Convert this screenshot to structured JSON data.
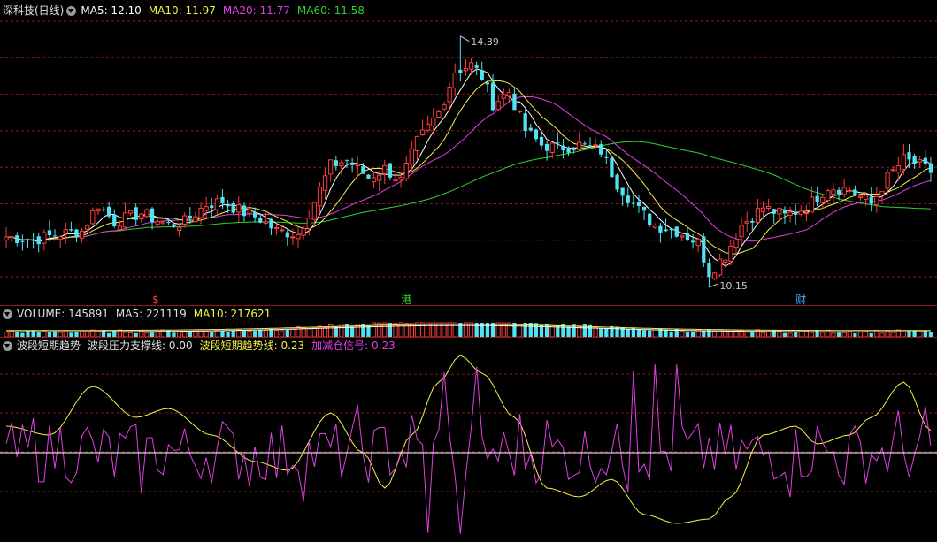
{
  "colors": {
    "up": "#ff3b3b",
    "down": "#50e3f3",
    "ma5": "#ffffff",
    "ma10": "#f4f04a",
    "ma20": "#e040e0",
    "ma60": "#30d030",
    "grid": "#8b1a1a",
    "zero_line": "#ffffff",
    "price_label": "#c8c8c8"
  },
  "main": {
    "title": "深科技(日线)",
    "ma5_label": "MA5: 12.10",
    "ma10_label": "MA10: 11.97",
    "ma20_label": "MA20: 11.77",
    "ma60_label": "MA60: 11.58",
    "high_label": "14.39",
    "low_label": "10.15",
    "markers": [
      {
        "text": "$",
        "color": "#ff3b3b",
        "x_index": 28
      },
      {
        "text": "港",
        "color": "#30d030",
        "x_index": 74
      },
      {
        "text": "财",
        "color": "#4aa8ff",
        "x_index": 147
      }
    ]
  },
  "volume": {
    "title": "VOLUME: 145891",
    "ma5_label": "MA5: 221119",
    "ma10_label": "MA10: 217621"
  },
  "indicator": {
    "title": "波段短期趋势",
    "support_label": "波段压力支撑线: 0.00",
    "trend_label": "波段短期趋势线: 0.23",
    "signal_label": "加减仓信号: 0.23"
  },
  "chart_data": {
    "type": "candlestick",
    "y_range": [
      10.0,
      14.7
    ],
    "count": 172,
    "anchors_close": [
      [
        0,
        11.0
      ],
      [
        5,
        10.95
      ],
      [
        10,
        11.05
      ],
      [
        14,
        11.1
      ],
      [
        17,
        11.55
      ],
      [
        20,
        11.25
      ],
      [
        25,
        11.4
      ],
      [
        30,
        11.2
      ],
      [
        33,
        11.25
      ],
      [
        37,
        11.55
      ],
      [
        40,
        11.6
      ],
      [
        43,
        11.45
      ],
      [
        47,
        11.3
      ],
      [
        50,
        11.1
      ],
      [
        54,
        11.05
      ],
      [
        57,
        11.6
      ],
      [
        60,
        12.2
      ],
      [
        63,
        12.3
      ],
      [
        67,
        12.0
      ],
      [
        70,
        12.15
      ],
      [
        73,
        11.95
      ],
      [
        76,
        12.6
      ],
      [
        80,
        13.1
      ],
      [
        83,
        13.8
      ],
      [
        86,
        13.9
      ],
      [
        88,
        13.7
      ],
      [
        90,
        13.25
      ],
      [
        93,
        13.45
      ],
      [
        96,
        12.8
      ],
      [
        99,
        12.55
      ],
      [
        102,
        12.5
      ],
      [
        106,
        12.55
      ],
      [
        110,
        12.45
      ],
      [
        113,
        11.9
      ],
      [
        117,
        11.45
      ],
      [
        120,
        11.2
      ],
      [
        124,
        11.1
      ],
      [
        128,
        10.9
      ],
      [
        130,
        10.4
      ],
      [
        133,
        10.7
      ],
      [
        136,
        11.2
      ],
      [
        140,
        11.5
      ],
      [
        144,
        11.35
      ],
      [
        148,
        11.5
      ],
      [
        152,
        11.85
      ],
      [
        156,
        11.8
      ],
      [
        160,
        11.55
      ],
      [
        163,
        12.0
      ],
      [
        166,
        12.3
      ],
      [
        169,
        12.2
      ],
      [
        171,
        12.1
      ]
    ],
    "high": 14.39,
    "high_index": 84,
    "low": 10.15,
    "low_index": 130,
    "latest": {
      "ma5": 12.1,
      "ma10": 11.97,
      "ma20": 11.77,
      "ma60": 11.58
    },
    "volume_latest": 145891,
    "volume_ma5": 221119,
    "volume_ma10": 217621,
    "indicator_latest": {
      "support": 0.0,
      "trend": 0.23,
      "signal": 0.23
    }
  }
}
